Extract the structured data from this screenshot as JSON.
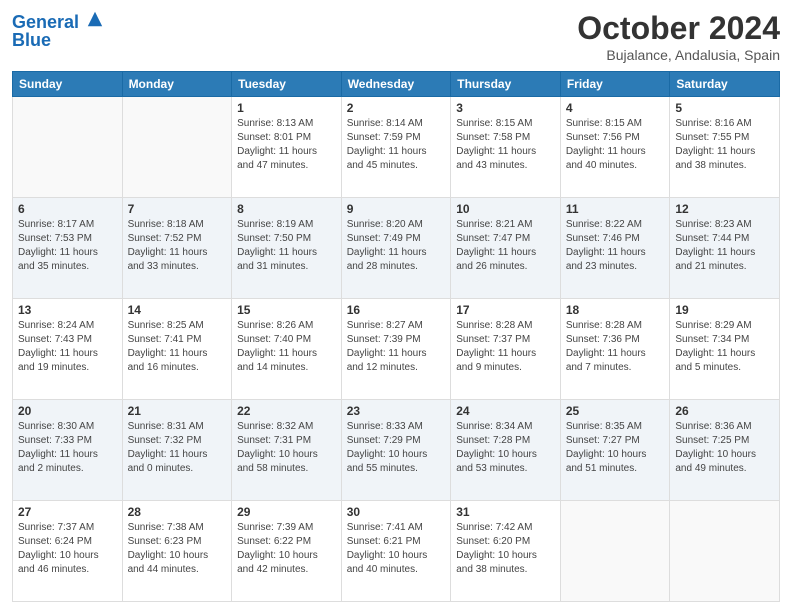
{
  "header": {
    "logo_line1": "General",
    "logo_line2": "Blue",
    "month": "October 2024",
    "location": "Bujalance, Andalusia, Spain"
  },
  "weekdays": [
    "Sunday",
    "Monday",
    "Tuesday",
    "Wednesday",
    "Thursday",
    "Friday",
    "Saturday"
  ],
  "weeks": [
    [
      {
        "day": "",
        "info": ""
      },
      {
        "day": "",
        "info": ""
      },
      {
        "day": "1",
        "info": "Sunrise: 8:13 AM\nSunset: 8:01 PM\nDaylight: 11 hours and 47 minutes."
      },
      {
        "day": "2",
        "info": "Sunrise: 8:14 AM\nSunset: 7:59 PM\nDaylight: 11 hours and 45 minutes."
      },
      {
        "day": "3",
        "info": "Sunrise: 8:15 AM\nSunset: 7:58 PM\nDaylight: 11 hours and 43 minutes."
      },
      {
        "day": "4",
        "info": "Sunrise: 8:15 AM\nSunset: 7:56 PM\nDaylight: 11 hours and 40 minutes."
      },
      {
        "day": "5",
        "info": "Sunrise: 8:16 AM\nSunset: 7:55 PM\nDaylight: 11 hours and 38 minutes."
      }
    ],
    [
      {
        "day": "6",
        "info": "Sunrise: 8:17 AM\nSunset: 7:53 PM\nDaylight: 11 hours and 35 minutes."
      },
      {
        "day": "7",
        "info": "Sunrise: 8:18 AM\nSunset: 7:52 PM\nDaylight: 11 hours and 33 minutes."
      },
      {
        "day": "8",
        "info": "Sunrise: 8:19 AM\nSunset: 7:50 PM\nDaylight: 11 hours and 31 minutes."
      },
      {
        "day": "9",
        "info": "Sunrise: 8:20 AM\nSunset: 7:49 PM\nDaylight: 11 hours and 28 minutes."
      },
      {
        "day": "10",
        "info": "Sunrise: 8:21 AM\nSunset: 7:47 PM\nDaylight: 11 hours and 26 minutes."
      },
      {
        "day": "11",
        "info": "Sunrise: 8:22 AM\nSunset: 7:46 PM\nDaylight: 11 hours and 23 minutes."
      },
      {
        "day": "12",
        "info": "Sunrise: 8:23 AM\nSunset: 7:44 PM\nDaylight: 11 hours and 21 minutes."
      }
    ],
    [
      {
        "day": "13",
        "info": "Sunrise: 8:24 AM\nSunset: 7:43 PM\nDaylight: 11 hours and 19 minutes."
      },
      {
        "day": "14",
        "info": "Sunrise: 8:25 AM\nSunset: 7:41 PM\nDaylight: 11 hours and 16 minutes."
      },
      {
        "day": "15",
        "info": "Sunrise: 8:26 AM\nSunset: 7:40 PM\nDaylight: 11 hours and 14 minutes."
      },
      {
        "day": "16",
        "info": "Sunrise: 8:27 AM\nSunset: 7:39 PM\nDaylight: 11 hours and 12 minutes."
      },
      {
        "day": "17",
        "info": "Sunrise: 8:28 AM\nSunset: 7:37 PM\nDaylight: 11 hours and 9 minutes."
      },
      {
        "day": "18",
        "info": "Sunrise: 8:28 AM\nSunset: 7:36 PM\nDaylight: 11 hours and 7 minutes."
      },
      {
        "day": "19",
        "info": "Sunrise: 8:29 AM\nSunset: 7:34 PM\nDaylight: 11 hours and 5 minutes."
      }
    ],
    [
      {
        "day": "20",
        "info": "Sunrise: 8:30 AM\nSunset: 7:33 PM\nDaylight: 11 hours and 2 minutes."
      },
      {
        "day": "21",
        "info": "Sunrise: 8:31 AM\nSunset: 7:32 PM\nDaylight: 11 hours and 0 minutes."
      },
      {
        "day": "22",
        "info": "Sunrise: 8:32 AM\nSunset: 7:31 PM\nDaylight: 10 hours and 58 minutes."
      },
      {
        "day": "23",
        "info": "Sunrise: 8:33 AM\nSunset: 7:29 PM\nDaylight: 10 hours and 55 minutes."
      },
      {
        "day": "24",
        "info": "Sunrise: 8:34 AM\nSunset: 7:28 PM\nDaylight: 10 hours and 53 minutes."
      },
      {
        "day": "25",
        "info": "Sunrise: 8:35 AM\nSunset: 7:27 PM\nDaylight: 10 hours and 51 minutes."
      },
      {
        "day": "26",
        "info": "Sunrise: 8:36 AM\nSunset: 7:25 PM\nDaylight: 10 hours and 49 minutes."
      }
    ],
    [
      {
        "day": "27",
        "info": "Sunrise: 7:37 AM\nSunset: 6:24 PM\nDaylight: 10 hours and 46 minutes."
      },
      {
        "day": "28",
        "info": "Sunrise: 7:38 AM\nSunset: 6:23 PM\nDaylight: 10 hours and 44 minutes."
      },
      {
        "day": "29",
        "info": "Sunrise: 7:39 AM\nSunset: 6:22 PM\nDaylight: 10 hours and 42 minutes."
      },
      {
        "day": "30",
        "info": "Sunrise: 7:41 AM\nSunset: 6:21 PM\nDaylight: 10 hours and 40 minutes."
      },
      {
        "day": "31",
        "info": "Sunrise: 7:42 AM\nSunset: 6:20 PM\nDaylight: 10 hours and 38 minutes."
      },
      {
        "day": "",
        "info": ""
      },
      {
        "day": "",
        "info": ""
      }
    ]
  ]
}
